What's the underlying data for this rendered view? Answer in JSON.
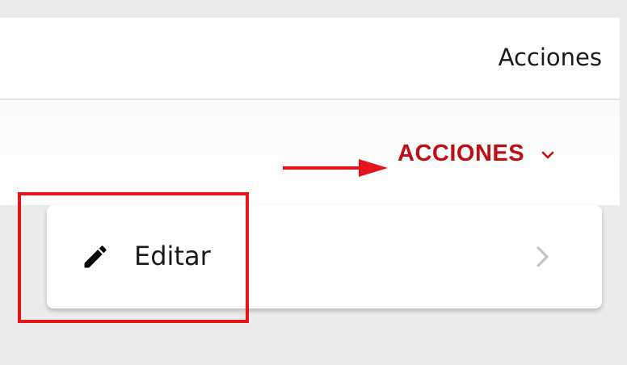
{
  "table": {
    "header_label": "Acciones"
  },
  "actions_button": {
    "label": "ACCIONES",
    "icon": "chevron-down-icon",
    "color": "#bf0f14"
  },
  "menu": {
    "items": [
      {
        "label": "Editar",
        "icon": "pencil-icon",
        "trailing_icon": "chevron-right-icon"
      }
    ]
  },
  "annotations": {
    "arrow_color": "#e8141b",
    "highlight_color": "#e8141b"
  }
}
